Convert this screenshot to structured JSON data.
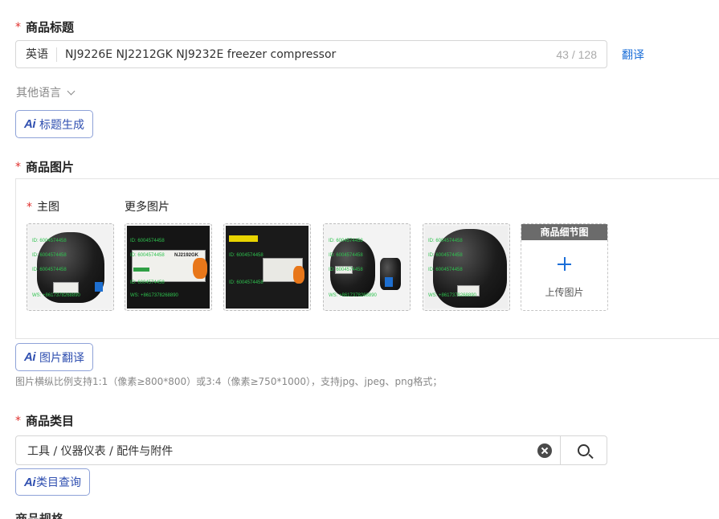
{
  "title_section": {
    "label": "商品标题",
    "required_mark": "*",
    "language": "英语",
    "value": "NJ9226E NJ2212GK NJ9232E freezer compressor",
    "char_count": "43 / 128",
    "translate_label": "翻译",
    "other_languages": "其他语言",
    "ai_button": "标题生成"
  },
  "images_section": {
    "label": "商品图片",
    "required_mark": "*",
    "main_label": "主图",
    "more_label": "更多图片",
    "watermark_id": "ID: 6004574458",
    "watermark_ws": "WS: +8617378268890",
    "plate_model": "NJ2192GK",
    "upload_slot_title": "商品细节图",
    "upload_label": "上传图片",
    "ai_button": "图片翻译",
    "hint": "图片横纵比例支持1:1（像素≥800*800）或3:4（像素≥750*1000），支持jpg、jpeg、png格式；"
  },
  "category_section": {
    "label": "商品类目",
    "required_mark": "*",
    "value": "工具 / 仪器仪表 / 配件与附件",
    "ai_button": "类目查询"
  },
  "next_section": {
    "label": "商品规格"
  },
  "ai_mark": "Ai",
  "colors": {
    "accent": "#1a6ed8",
    "required": "#e0302d",
    "ai_text": "#2f4fb0",
    "watermark": "#2ec24e"
  }
}
